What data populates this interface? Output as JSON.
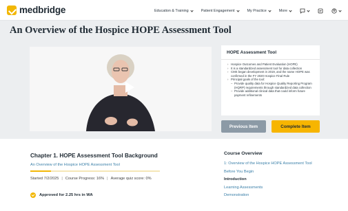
{
  "brand": {
    "name": "medbridge",
    "color": "#f2b705"
  },
  "nav": {
    "items": [
      {
        "label": "Education & Training"
      },
      {
        "label": "Patient Engagement"
      },
      {
        "label": "My Practice"
      },
      {
        "label": "More"
      }
    ],
    "icons": [
      "chat-icon",
      "inbox-icon",
      "account-icon"
    ]
  },
  "page": {
    "title": "An Overview of the Hospice HOPE Assessment Tool"
  },
  "panel": {
    "title": "HOPE Assessment Tool",
    "bullets": [
      "Hospice Outcomes and Patient Evaluation (HOPE)",
      "It is a standardized assessment tool for data collection",
      "CMS began development in 2019, and the name HOPE was confirmed in the FY 2020 Hospice Final Rule",
      "Principal goals of the tool:"
    ],
    "sub_bullets": [
      "Provide quality data for Hospice Quality Reporting Program (HQRP) requirements through standardized data collection",
      "Provide additional clinical data that could inform future payment refinements"
    ]
  },
  "buttons": {
    "previous": "Previous Item",
    "complete": "Complete Item"
  },
  "chapter": {
    "title": "Chapter 1. HOPE Assessment Tool Background",
    "subtitle": "An Overview of the Hospice HOPE Assessment Tool",
    "progress": 0.16,
    "started": "Started 7/2/2025",
    "course_progress": "Course Progress: 16%",
    "quiz": "Average quiz score: 0%",
    "approved": "Approved for 2.25 hrs in WA"
  },
  "overview": {
    "title": "Course Overview",
    "items": [
      {
        "label": "1: Overview of the Hospice HOPE Assessment Tool",
        "style": "link"
      },
      {
        "label": "Before You Begin",
        "style": "link"
      },
      {
        "label": "Introduction",
        "style": "bold"
      },
      {
        "label": "Learning Assessments",
        "style": "link"
      },
      {
        "label": "Demonstration",
        "style": "link"
      }
    ]
  }
}
